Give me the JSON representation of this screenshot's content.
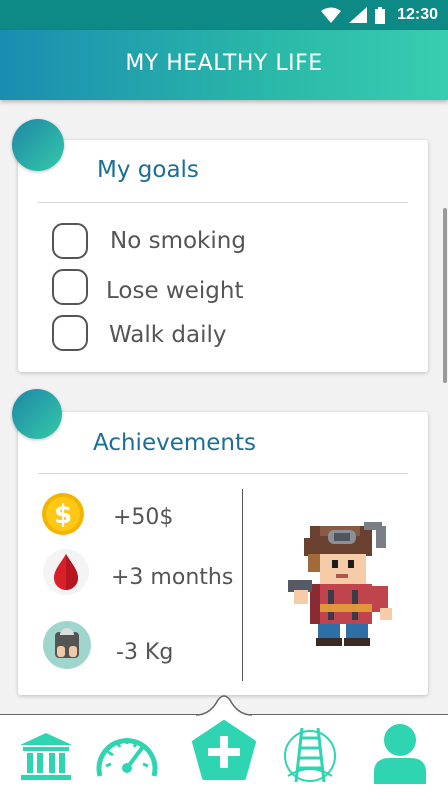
{
  "status_bar": {
    "time": "12:30"
  },
  "header": {
    "title": "MY HEALTHY LIFE"
  },
  "goals": {
    "title": "My goals",
    "items": [
      {
        "label": "No smoking",
        "checked": false
      },
      {
        "label": "Lose weight",
        "checked": false
      },
      {
        "label": "Walk daily",
        "checked": false
      }
    ]
  },
  "achievements": {
    "title": "Achievements",
    "items": [
      {
        "icon": "coin-dollar-icon",
        "value": "+50$"
      },
      {
        "icon": "blood-drop-icon",
        "value": "+3 months"
      },
      {
        "icon": "weight-scale-icon",
        "value": "-3 Kg"
      }
    ],
    "avatar": "pixel-character-avatar"
  },
  "bottom_nav": {
    "items": [
      {
        "icon": "bank-icon"
      },
      {
        "icon": "speedometer-icon"
      },
      {
        "icon": "add-plus-icon"
      },
      {
        "icon": "ladder-icon"
      },
      {
        "icon": "profile-icon"
      }
    ]
  },
  "colors": {
    "accent": "#34d6b2",
    "title_blue": "#1b6f97",
    "header_start": "#1a8db1",
    "header_end": "#38cdb0"
  }
}
